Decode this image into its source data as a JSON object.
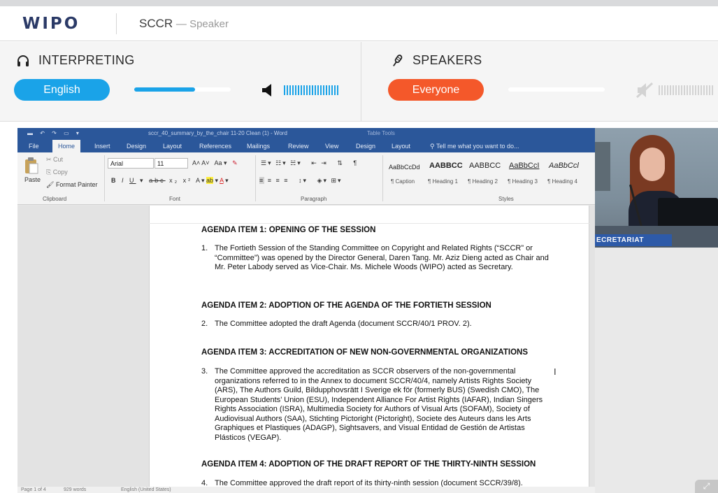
{
  "header": {
    "logo": "WIPO",
    "title": "SCCR",
    "subtitle": "— Speaker"
  },
  "interpreting": {
    "title": "INTERPRETING",
    "language": "English",
    "volume_fraction": 0.63
  },
  "speakers": {
    "title": "SPEAKERS",
    "selection": "Everyone",
    "volume_fraction": 0.0
  },
  "word": {
    "window_title": "sccr_40_summary_by_the_chair 11-20 Clean (1) - Word",
    "context_tab_group": "Table Tools",
    "tabs": [
      "File",
      "Home",
      "Insert",
      "Design",
      "Layout",
      "References",
      "Mailings",
      "Review",
      "View",
      "Design",
      "Layout"
    ],
    "tell_me": "Tell me what you want to do...",
    "clipboard": {
      "paste": "Paste",
      "cut": "Cut",
      "copy": "Copy",
      "format_painter": "Format Painter",
      "label": "Clipboard"
    },
    "font": {
      "name": "Arial",
      "size": "11",
      "label": "Font"
    },
    "paragraph_label": "Paragraph",
    "styles_label": "Styles",
    "styles": [
      {
        "sample": "AaBbCcDd",
        "name": "¶ Caption"
      },
      {
        "sample": "AABBCC",
        "name": "¶ Heading 1"
      },
      {
        "sample": "AABBCC",
        "name": "¶ Heading 2"
      },
      {
        "sample": "AaBbCcI",
        "name": "¶ Heading 3"
      },
      {
        "sample": "AaBbCcl",
        "name": "¶ Heading 4"
      }
    ],
    "status": {
      "page": "Page 1 of 4",
      "words": "929 words",
      "language": "English (United States)"
    }
  },
  "document": {
    "items": [
      {
        "heading": "AGENDA ITEM 1:  OPENING OF THE SESSION",
        "num": "1.",
        "text": "The Fortieth Session of the Standing Committee on Copyright and Related Rights (“SCCR” or “Committee”) was opened by the Director General, Daren Tang.  Mr. Aziz Dieng acted as Chair and Mr. Peter Labody served as Vice-Chair.  Ms. Michele Woods (WIPO) acted as Secretary."
      },
      {
        "heading": "AGENDA ITEM 2:  ADOPTION OF THE AGENDA OF THE FORTIETH SESSION",
        "num": "2.",
        "text": "The Committee adopted the draft Agenda (document SCCR/40/1 PROV. 2)."
      },
      {
        "heading": "AGENDA ITEM 3:  ACCREDITATION OF NEW NON-GOVERNMENTAL ORGANIZATIONS",
        "num": "3.",
        "text": "The Committee approved the accreditation as SCCR observers of the non-governmental organizations referred to in the Annex to document SCCR/40/4, namely Artists Rights Society (ARS), The Authors Guild, Bildupphovsrätt I Sverige ek för (formerly BUS) (Swedish CMO), The European Students’ Union (ESU), Independent Alliance For Artist Rights (IAFAR),  Indian Singers Rights Association (ISRA), Multimedia Society for Authors of Visual Arts (SOFAM), Society of Audiovisual Authors (SAA), Stichting Pictoright (Pictoright), Societe des Auteurs dans les Arts Graphiques et Plastiques (ADAGP), Sightsavers, and Visual Entidad de Gestión de Artistas Plásticos (VEGAP)."
      },
      {
        "heading": "AGENDA ITEM 4:  ADOPTION OF THE DRAFT REPORT OF THE THIRTY-NINTH SESSION",
        "num": "4.",
        "text": "The Committee approved the draft report of its thirty-ninth session (document SCCR/39/8)."
      }
    ]
  },
  "camera": {
    "caption": "ECRETARIAT"
  },
  "icons": {
    "interpreting": "headphones-icon",
    "speakers": "microphone-icon",
    "volume": "speaker-icon",
    "muted": "muted-icon",
    "expand": "expand-icon"
  },
  "colors": {
    "accent_blue": "#1aa3e8",
    "accent_orange": "#f4582a",
    "word_blue": "#2b579a"
  }
}
